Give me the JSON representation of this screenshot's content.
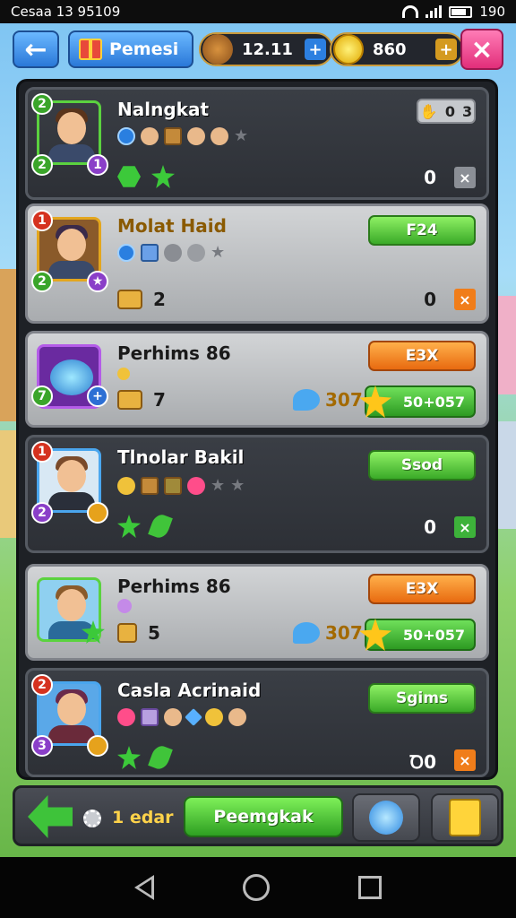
{
  "status_bar": {
    "time": "Cesaa 13 95109",
    "battery": "190"
  },
  "top_bar": {
    "gift_label": "Pemesi",
    "wood_amount": "12.11",
    "coin_amount": "860",
    "plus": "+",
    "close": "×"
  },
  "cards": [
    {
      "name": "Nalngkat",
      "levels": [
        "2",
        "2",
        "1"
      ],
      "badge_a": "0",
      "badge_b": "3",
      "zero": "0",
      "x": "×"
    },
    {
      "name": "Molat Haid",
      "levels": [
        "1",
        "2"
      ],
      "button": "F24",
      "count": "2",
      "zero": "0",
      "x": "×"
    },
    {
      "name": "Perhims 86",
      "levels": [
        "7"
      ],
      "button": "E3X",
      "count": "7",
      "reward": "307",
      "trophy": "50+057"
    },
    {
      "name": "Tlnolar Bakil",
      "levels": [
        "1",
        "2"
      ],
      "button": "Ssod",
      "zero": "0",
      "x": "×"
    },
    {
      "name": "Perhims 86",
      "button": "E3X",
      "count": "5",
      "reward": "307",
      "trophy": "50+057"
    },
    {
      "name": "Casla Acrinaid",
      "levels": [
        "2",
        "3"
      ],
      "button": "Sgims",
      "zero": "Ꝺ0",
      "x": "×"
    }
  ],
  "bottom_bar": {
    "level_text": "1 edar",
    "upgrade_label": "Peemgkak"
  }
}
